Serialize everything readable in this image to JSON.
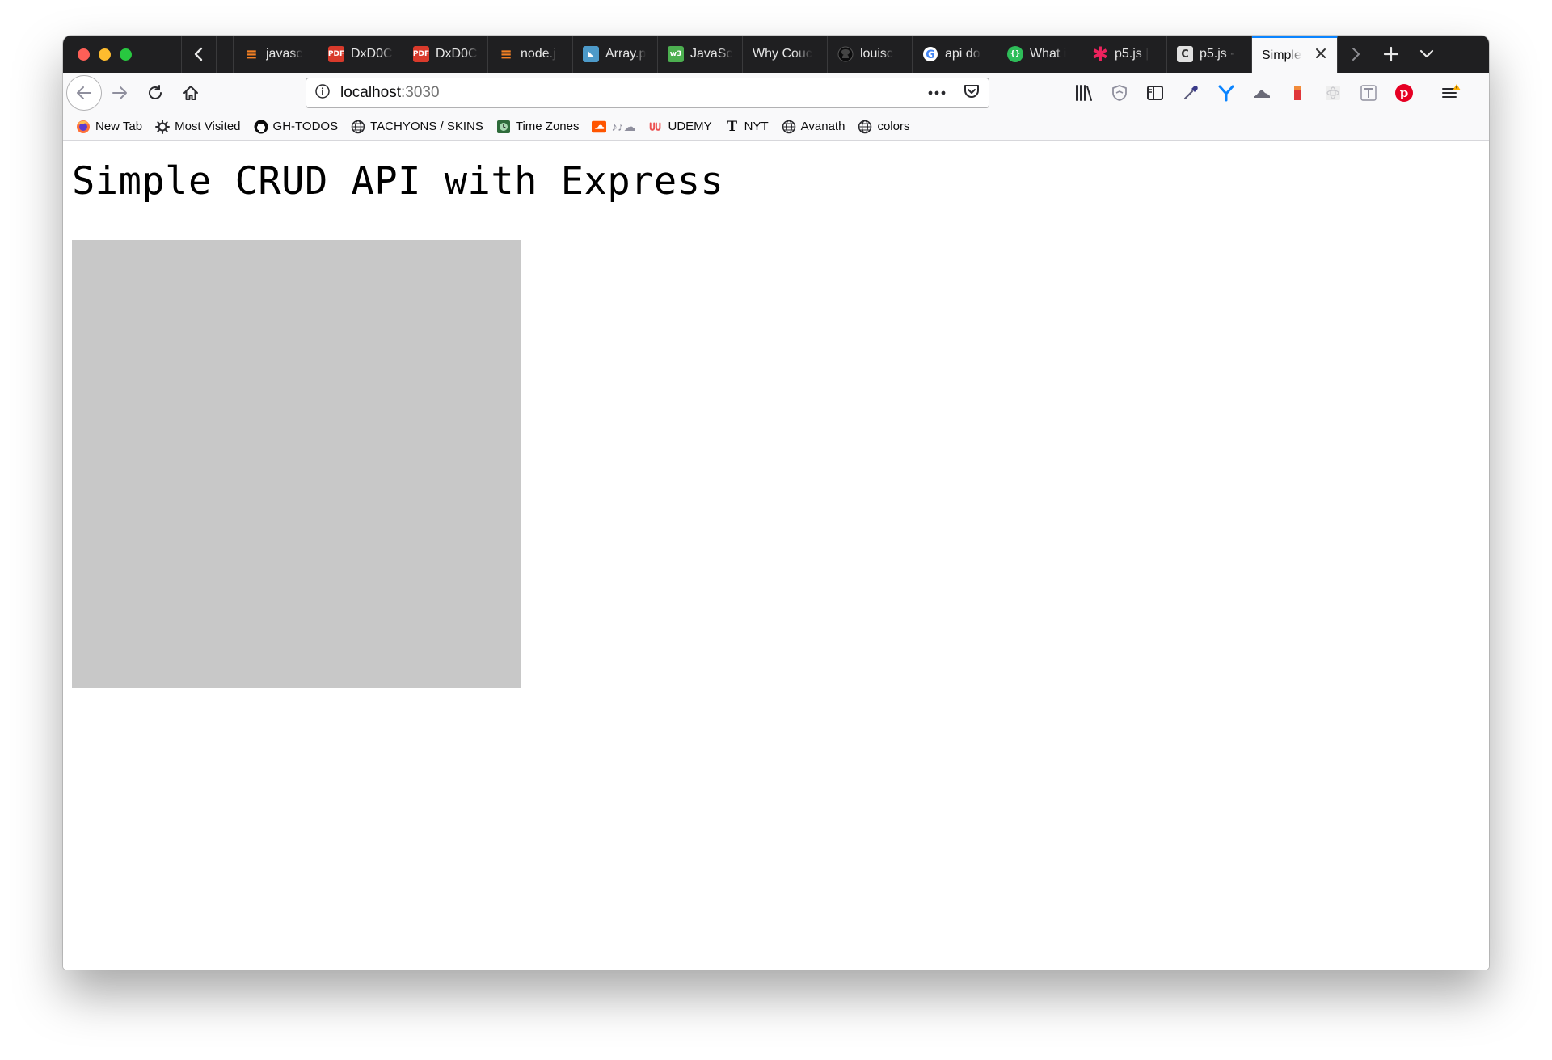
{
  "tabs": [
    {
      "label": "javasc",
      "favicon": "stackoverflow-icon",
      "color": "#f48024"
    },
    {
      "label": "DxD0C",
      "favicon": "pdf-icon",
      "color": "#d93a2b"
    },
    {
      "label": "DxD0C",
      "favicon": "pdf-icon",
      "color": "#d93a2b"
    },
    {
      "label": "node.j",
      "favicon": "stackoverflow-icon",
      "color": "#f48024"
    },
    {
      "label": "Array.p",
      "favicon": "mdn-icon",
      "color": "#4d9ac9"
    },
    {
      "label": "JavaSc",
      "favicon": "w3schools-icon",
      "color": "#4caf50"
    },
    {
      "label": "Why Couc",
      "favicon": "",
      "color": ""
    },
    {
      "label": "louisc",
      "favicon": "github-icon",
      "color": "#1f1f21"
    },
    {
      "label": "api do",
      "favicon": "google-icon",
      "color": "#4285f4"
    },
    {
      "label": "What i",
      "favicon": "globe-green-icon",
      "color": "#2ebd59"
    },
    {
      "label": "p5.js |",
      "favicon": "p5-asterisk-icon",
      "color": "#ed225d"
    },
    {
      "label": "p5.js -",
      "favicon": "c-letter-icon",
      "color": "#e0e0e0"
    }
  ],
  "active_tab": {
    "label": "Simple"
  },
  "nav": {
    "url_host": "localhost",
    "url_port": ":3030"
  },
  "bookmarks": [
    {
      "label": "New Tab",
      "icon": "firefox-icon"
    },
    {
      "label": "Most Visited",
      "icon": "gear-icon"
    },
    {
      "label": "GH-TODOS",
      "icon": "github-icon"
    },
    {
      "label": "TACHYONS / SKINS",
      "icon": "globe-icon"
    },
    {
      "label": "Time Zones",
      "icon": "clock-map-icon"
    },
    {
      "label": "♪♪☁",
      "icon": "soundcloud-icon"
    },
    {
      "label": "UDEMY",
      "icon": "udemy-icon"
    },
    {
      "label": "NYT",
      "icon": "nyt-icon"
    },
    {
      "label": "Avanath",
      "icon": "globe-icon"
    },
    {
      "label": "colors",
      "icon": "globe-icon"
    }
  ],
  "page": {
    "title": "Simple CRUD API with Express",
    "canvas_color": "#c8c8c8"
  },
  "colors": {
    "tabstrip_bg": "#1f1f21",
    "active_tab_accent": "#0a84ff",
    "toolbar_bg": "#f9f9fa"
  }
}
